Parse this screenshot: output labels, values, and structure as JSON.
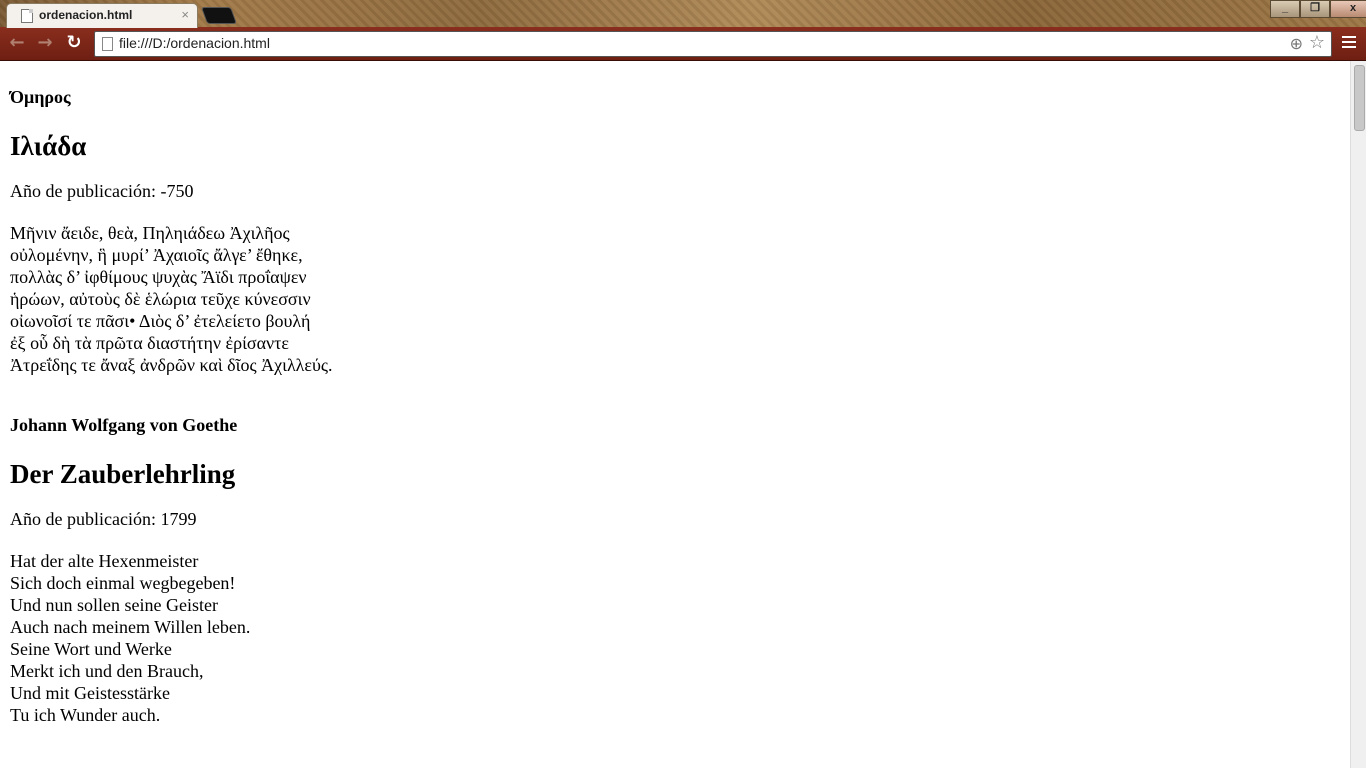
{
  "browser": {
    "tab_title": "ordenacion.html",
    "tab_close": "×",
    "address": "file:///D:/ordenacion.html",
    "win_min": "_",
    "win_max": "❐",
    "win_close": "x",
    "back": "←",
    "forward": "→",
    "reload": "↻",
    "zoom": "⊕",
    "star": "☆"
  },
  "works": [
    {
      "author": "Όμηρος",
      "title": "Ιλιάδα",
      "year_text": "Año de publicación: -750",
      "lines": [
        "Μῆνιν ἄειδε, θεὰ, Πηληιάδεω Ἀχιλῆος",
        "οὐλομένην, ἣ μυρί’ Ἀχαιοῖς ἄλγε’ ἔθηκε,",
        "πολλὰς δ’ ἰφθίμους ψυχὰς Ἄϊδι προΐαψεν",
        "ἡρώων, αὐτοὺς δὲ ἑλώρια τεῦχε κύνεσσιν",
        "οἰωνοῖσί τε πᾶσι• Διὸς δ’ ἐτελείετο βουλή",
        "ἐξ οὗ δὴ τὰ πρῶτα διαστήτην ἐρίσαντε",
        "Ἀτρεΐδης τε ἄναξ ἀνδρῶν καὶ δῖος Ἀχιλλεύς."
      ]
    },
    {
      "author": "Johann Wolfgang von Goethe",
      "title": "Der Zauberlehrling",
      "year_text": "Año de publicación: 1799",
      "lines": [
        "Hat der alte Hexenmeister",
        "Sich doch einmal wegbegeben!",
        "Und nun sollen seine Geister",
        "Auch nach meinem Willen leben.",
        "Seine Wort und Werke",
        "Merkt ich und den Brauch,",
        "Und mit Geistesstärke",
        "Tu ich Wunder auch."
      ]
    }
  ]
}
